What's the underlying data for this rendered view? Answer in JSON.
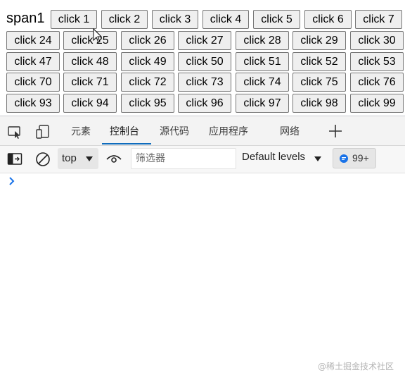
{
  "page": {
    "span_label": "span1",
    "buttons": [
      "click 1",
      "click 2",
      "click 3",
      "click 4",
      "click 5",
      "click 6",
      "click 7",
      "click 24",
      "click 25",
      "click 26",
      "click 27",
      "click 28",
      "click 29",
      "click 30",
      "click 47",
      "click 48",
      "click 49",
      "click 50",
      "click 51",
      "click 52",
      "click 53",
      "click 70",
      "click 71",
      "click 72",
      "click 73",
      "click 74",
      "click 75",
      "click 76",
      "click 93",
      "click 94",
      "click 95",
      "click 96",
      "click 97",
      "click 98",
      "click 99"
    ]
  },
  "devtools": {
    "tabs": [
      {
        "label": "元素",
        "active": false
      },
      {
        "label": "控制台",
        "active": true
      },
      {
        "label": "源代码",
        "active": false
      },
      {
        "label": "应用程序",
        "active": false
      },
      {
        "label": "网络",
        "active": false
      }
    ],
    "add_tab_icon": "plus-icon",
    "toolbar": {
      "context": "top",
      "filter_placeholder": "筛选器",
      "filter_value": "",
      "levels": "Default levels",
      "issues_count": "99+"
    },
    "console_prompt_icon": "chevron-right-icon"
  },
  "watermark": "@稀土掘金技术社区",
  "colors": {
    "accent": "#0f6cbd",
    "button_bg": "#efefef",
    "button_border": "#767676",
    "issue_icon": "#1a73e8",
    "prompt": "#1a73e8"
  }
}
